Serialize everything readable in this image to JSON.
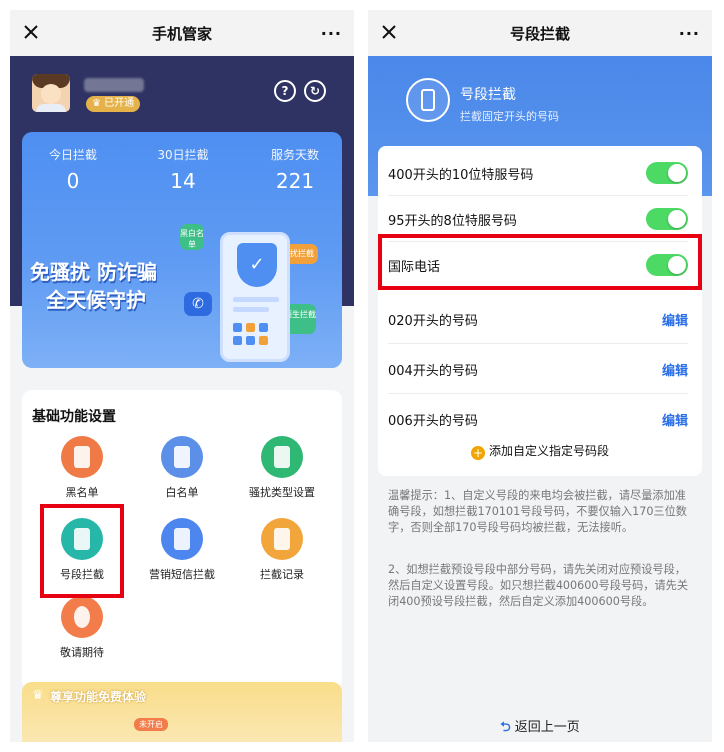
{
  "left_phone": {
    "title": "手机管家",
    "more": "···",
    "badge": "已开通",
    "help_icon": "question-circle-icon",
    "refresh_icon": "refresh-icon",
    "stats": [
      {
        "label": "今日拦截",
        "value": "0"
      },
      {
        "label": "30日拦截",
        "value": "14"
      },
      {
        "label": "服务天数",
        "value": "221"
      }
    ],
    "slogan": [
      "免骚扰 防诈骗",
      "全天候守护"
    ],
    "tags": {
      "whitelist": "黑白名单",
      "harass": "骚扰拦截",
      "stranger": "陌生拦截"
    },
    "basic_title": "基础功能设置",
    "functions": [
      {
        "label": "黑名单",
        "color": "#f07a45",
        "icon": "block-user-icon"
      },
      {
        "label": "白名单",
        "color": "#5b8fe8",
        "icon": "check-user-icon"
      },
      {
        "label": "骚扰类型设置",
        "color": "#2fb873",
        "icon": "phone-block-icon"
      },
      {
        "label": "号段拦截",
        "color": "#26b7a8",
        "icon": "phone-segment-icon"
      },
      {
        "label": "营销短信拦截",
        "color": "#4e86f0",
        "icon": "sms-block-icon"
      },
      {
        "label": "拦截记录",
        "color": "#f2a53a",
        "icon": "record-icon"
      },
      {
        "label": "敬请期待",
        "color": "#f27c4a",
        "icon": "alarm-clock-icon"
      }
    ],
    "promo": {
      "title": "尊享功能免费体验",
      "pill": "未开启"
    }
  },
  "right_phone": {
    "title": "号段拦截",
    "more": "···",
    "header_title": "号段拦截",
    "header_sub": "拦截固定开头的号码",
    "rows": [
      {
        "label": "400开头的10位特服号码",
        "type": "toggle",
        "on": true
      },
      {
        "label": "95开头的8位特服号码",
        "type": "toggle",
        "on": true
      },
      {
        "label": "国际电话",
        "type": "toggle",
        "on": true
      },
      {
        "label": "020开头的号码",
        "type": "edit",
        "action": "编辑"
      },
      {
        "label": "004开头的号码",
        "type": "edit",
        "action": "编辑"
      },
      {
        "label": "006开头的号码",
        "type": "edit",
        "action": "编辑"
      }
    ],
    "add_label": "添加自定义指定号码段",
    "tip1": "温馨提示：1、自定义号段的来电均会被拦截，请尽量添加准确号段，如想拦截170101号段号码，不要仅输入170三位数字，否则全部170号段号码均被拦截，无法接听。",
    "tip2": "2、如想拦截预设号段中部分号码，请先关闭对应预设号段，然后自定义设置号段。如只想拦截400600号段号码，请先关闭400预设号段拦截，然后自定义添加400600号段。",
    "back": "返回上一页"
  },
  "colors": {
    "toggle_on": "#4cd964",
    "highlight": "#e60012",
    "link": "#2a6ee8",
    "primary": "#4a88e9"
  }
}
